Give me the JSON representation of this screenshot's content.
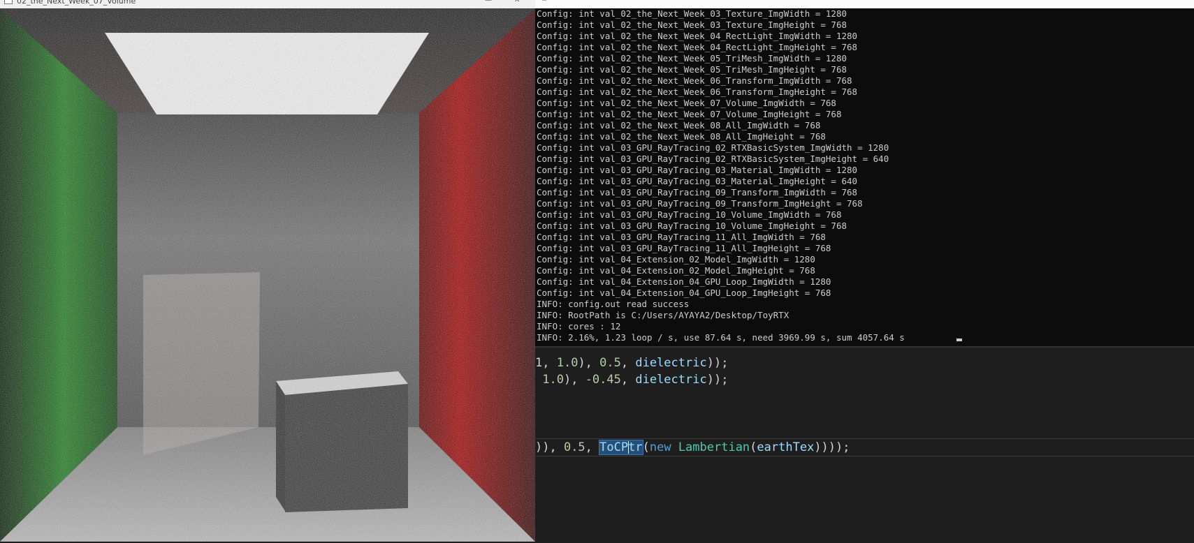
{
  "render_window": {
    "title": "02_the_Next_Week_07_Volume"
  },
  "console": {
    "lines": [
      "Config: int val_02_the_Next_Week_03_Texture_ImgWidth = 1280",
      "Config: int val_02_the_Next_Week_03_Texture_ImgHeight = 768",
      "Config: int val_02_the_Next_Week_04_RectLight_ImgWidth = 1280",
      "Config: int val_02_the_Next_Week_04_RectLight_ImgHeight = 768",
      "Config: int val_02_the_Next_Week_05_TriMesh_ImgWidth = 1280",
      "Config: int val_02_the_Next_Week_05_TriMesh_ImgHeight = 768",
      "Config: int val_02_the_Next_Week_06_Transform_ImgWidth = 768",
      "Config: int val_02_the_Next_Week_06_Transform_ImgHeight = 768",
      "Config: int val_02_the_Next_Week_07_Volume_ImgWidth = 768",
      "Config: int val_02_the_Next_Week_07_Volume_ImgHeight = 768",
      "Config: int val_02_the_Next_Week_08_All_ImgWidth = 768",
      "Config: int val_02_the_Next_Week_08_All_ImgHeight = 768",
      "Config: int val_03_GPU_RayTracing_02_RTXBasicSystem_ImgWidth = 1280",
      "Config: int val_03_GPU_RayTracing_02_RTXBasicSystem_ImgHeight = 640",
      "Config: int val_03_GPU_RayTracing_03_Material_ImgWidth = 1280",
      "Config: int val_03_GPU_RayTracing_03_Material_ImgHeight = 640",
      "Config: int val_03_GPU_RayTracing_09_Transform_ImgWidth = 768",
      "Config: int val_03_GPU_RayTracing_09_Transform_ImgHeight = 768",
      "Config: int val_03_GPU_RayTracing_10_Volume_ImgWidth = 768",
      "Config: int val_03_GPU_RayTracing_10_Volume_ImgHeight = 768",
      "Config: int val_03_GPU_RayTracing_11_All_ImgWidth = 768",
      "Config: int val_03_GPU_RayTracing_11_All_ImgHeight = 768",
      "Config: int val_04_Extension_02_Model_ImgWidth = 1280",
      "Config: int val_04_Extension_02_Model_ImgHeight = 768",
      "Config: int val_04_Extension_04_GPU_Loop_ImgWidth = 1280",
      "Config: int val_04_Extension_04_GPU_Loop_ImgHeight = 768",
      "INFO: config.out read success",
      "INFO: RootPath is C:/Users/AYAYA2/Desktop/ToyRTX",
      "INFO: cores : 12",
      "INFO: 2.16%, 1.23 loop / s, use 87.64 s, need 3969.99 s, sum 4057.64 s"
    ]
  },
  "editor": {
    "line1": {
      "pre": "1, ",
      "n1": "1.0",
      "mid": "), ",
      "n2": "0.5",
      "comma": ", ",
      "ident": "dielectric",
      "post": "));"
    },
    "line2": {
      "pre": " ",
      "n1": "1.0",
      "mid": "), ",
      "n2": "-0.45",
      "comma": ", ",
      "ident": "dielectric",
      "post": "));"
    },
    "line3": {
      "pre": ")), ",
      "n1": "0.5",
      "comma": ", ",
      "sel_a": "ToCP",
      "sel_b": "tr",
      "paren": "(",
      "kw": "new",
      "space": " ",
      "type": "Lambertian",
      "paren2": "(",
      "ident": "earthTex",
      "post": "))));"
    }
  },
  "colors": {
    "console_bg": "#0c0c0c",
    "console_text": "#cccccc",
    "editor_bg": "#1e1e1e",
    "wall_green": "#1a7a1a",
    "wall_red": "#a00000"
  }
}
